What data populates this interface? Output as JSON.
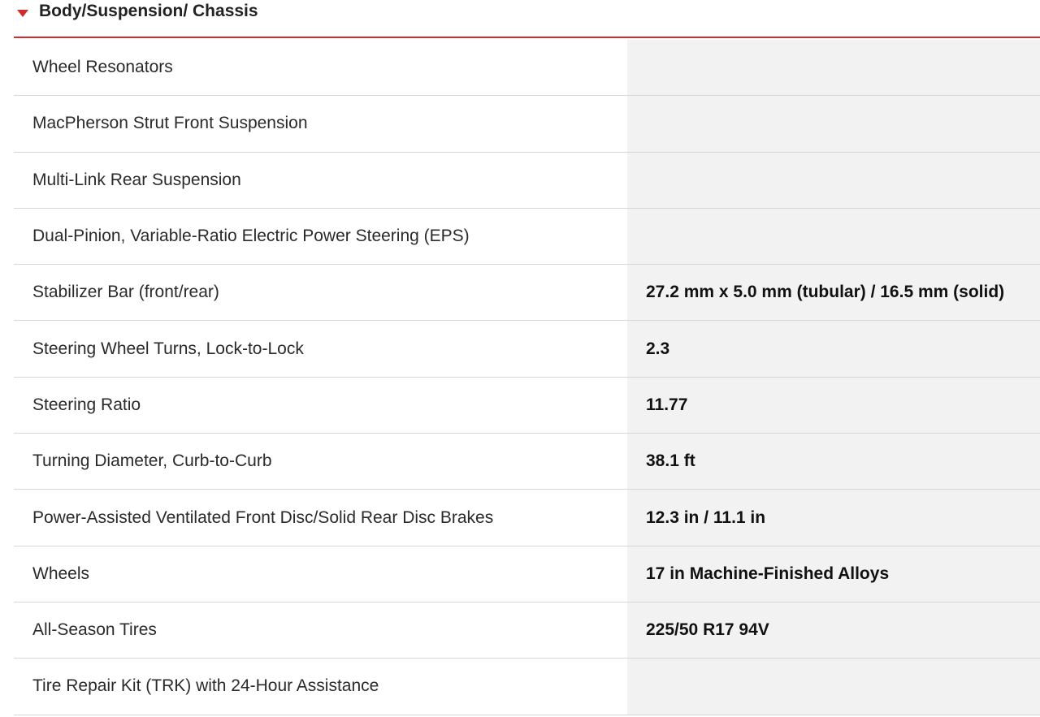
{
  "section": {
    "title": "Body/Suspension/ Chassis",
    "caret_icon": "caret-down-icon",
    "accent_color": "#d42a2a"
  },
  "rows": [
    {
      "label": "Wheel Resonators",
      "value": ""
    },
    {
      "label": "MacPherson Strut Front Suspension",
      "value": ""
    },
    {
      "label": "Multi-Link Rear Suspension",
      "value": ""
    },
    {
      "label": "Dual-Pinion, Variable-Ratio Electric Power Steering (EPS)",
      "value": ""
    },
    {
      "label": "Stabilizer Bar (front/rear)",
      "value": "27.2 mm x 5.0 mm (tubular) / 16.5 mm (solid)"
    },
    {
      "label": "Steering Wheel Turns, Lock-to-Lock",
      "value": "2.3"
    },
    {
      "label": "Steering Ratio",
      "value": "11.77"
    },
    {
      "label": "Turning Diameter, Curb-to-Curb",
      "value": "38.1 ft"
    },
    {
      "label": "Power-Assisted Ventilated Front Disc/Solid Rear Disc Brakes",
      "value": "12.3 in / 11.1 in"
    },
    {
      "label": "Wheels",
      "value": "17 in Machine-Finished Alloys"
    },
    {
      "label": "All-Season Tires",
      "value": "225/50 R17 94V"
    },
    {
      "label": "Tire Repair Kit (TRK) with 24-Hour Assistance",
      "value": ""
    }
  ]
}
